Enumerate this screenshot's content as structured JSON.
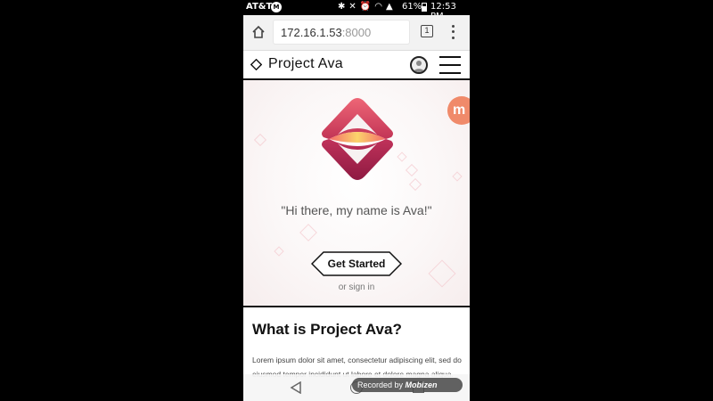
{
  "status_bar": {
    "carrier": "AT&T",
    "notif_badge": "M",
    "battery": "61%",
    "time": "12:53 PM"
  },
  "browser": {
    "url_host": "172.16.1.53",
    "url_port": ":8000",
    "tab_count": "1"
  },
  "site": {
    "title": "Project Ava"
  },
  "hero": {
    "badge_letter": "m",
    "greeting": "\"Hi there, my name is Ava!\"",
    "cta": "Get Started",
    "signin": "or sign in"
  },
  "content": {
    "heading": "What is Project Ava?",
    "body": "Lorem ipsum dolor sit amet, consectetur adipiscing elit, sed do eiusmod tempor incididunt ut labore et dolore magna aliqua."
  },
  "watermark": {
    "prefix": "Recorded by",
    "brand": "Mobizen"
  },
  "colors": {
    "logo_top": "#e4576f",
    "logo_bottom": "#9b1e49",
    "logo_band": "#f6b24d",
    "badge": "#f08a6a",
    "decor": "#f3c9cf"
  }
}
